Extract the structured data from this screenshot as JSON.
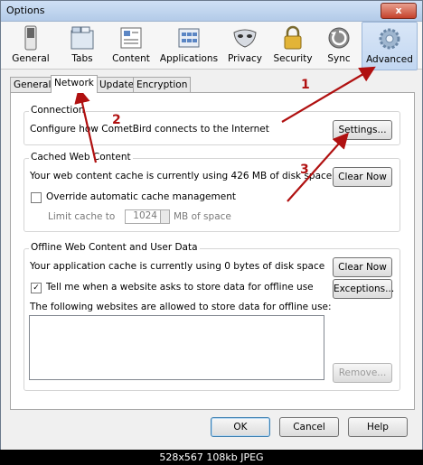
{
  "window": {
    "title": "Options",
    "close_label": "x"
  },
  "toolbar": {
    "items": [
      {
        "label": "General",
        "icon": "switch-icon"
      },
      {
        "label": "Tabs",
        "icon": "tabs-icon"
      },
      {
        "label": "Content",
        "icon": "content-icon"
      },
      {
        "label": "Applications",
        "icon": "applications-icon"
      },
      {
        "label": "Privacy",
        "icon": "mask-icon"
      },
      {
        "label": "Security",
        "icon": "lock-icon"
      },
      {
        "label": "Sync",
        "icon": "sync-icon"
      },
      {
        "label": "Advanced",
        "icon": "gear-icon",
        "selected": true
      }
    ]
  },
  "subtabs": [
    "General",
    "Network",
    "Update",
    "Encryption"
  ],
  "active_subtab": "Network",
  "connection": {
    "title": "Connection",
    "description": "Configure how CometBird connects to the Internet",
    "settings_button": "Settings..."
  },
  "cache": {
    "title": "Cached Web Content",
    "status": "Your web content cache is currently using 426 MB of disk space",
    "clear_button": "Clear Now",
    "override_label": "Override automatic cache management",
    "override_checked": false,
    "limit_label": "Limit cache to",
    "limit_value": "1024",
    "limit_unit": "MB of space"
  },
  "offline": {
    "title": "Offline Web Content and User Data",
    "status": "Your application cache is currently using 0 bytes of disk space",
    "clear_button": "Clear Now",
    "tell_me_label": "Tell me when a website asks to store data for offline use",
    "tell_me_checked": true,
    "check_mark": "✓",
    "exceptions_button": "Exceptions...",
    "allowed_label": "The following websites are allowed to store data for offline use:",
    "remove_button": "Remove..."
  },
  "footer": {
    "ok": "OK",
    "cancel": "Cancel",
    "help": "Help"
  },
  "caption": "528x567  108kb  JPEG",
  "annotations": [
    "1",
    "2",
    "3"
  ],
  "colors": {
    "accent": "#c2d7f1",
    "arrow": "#b01010"
  }
}
